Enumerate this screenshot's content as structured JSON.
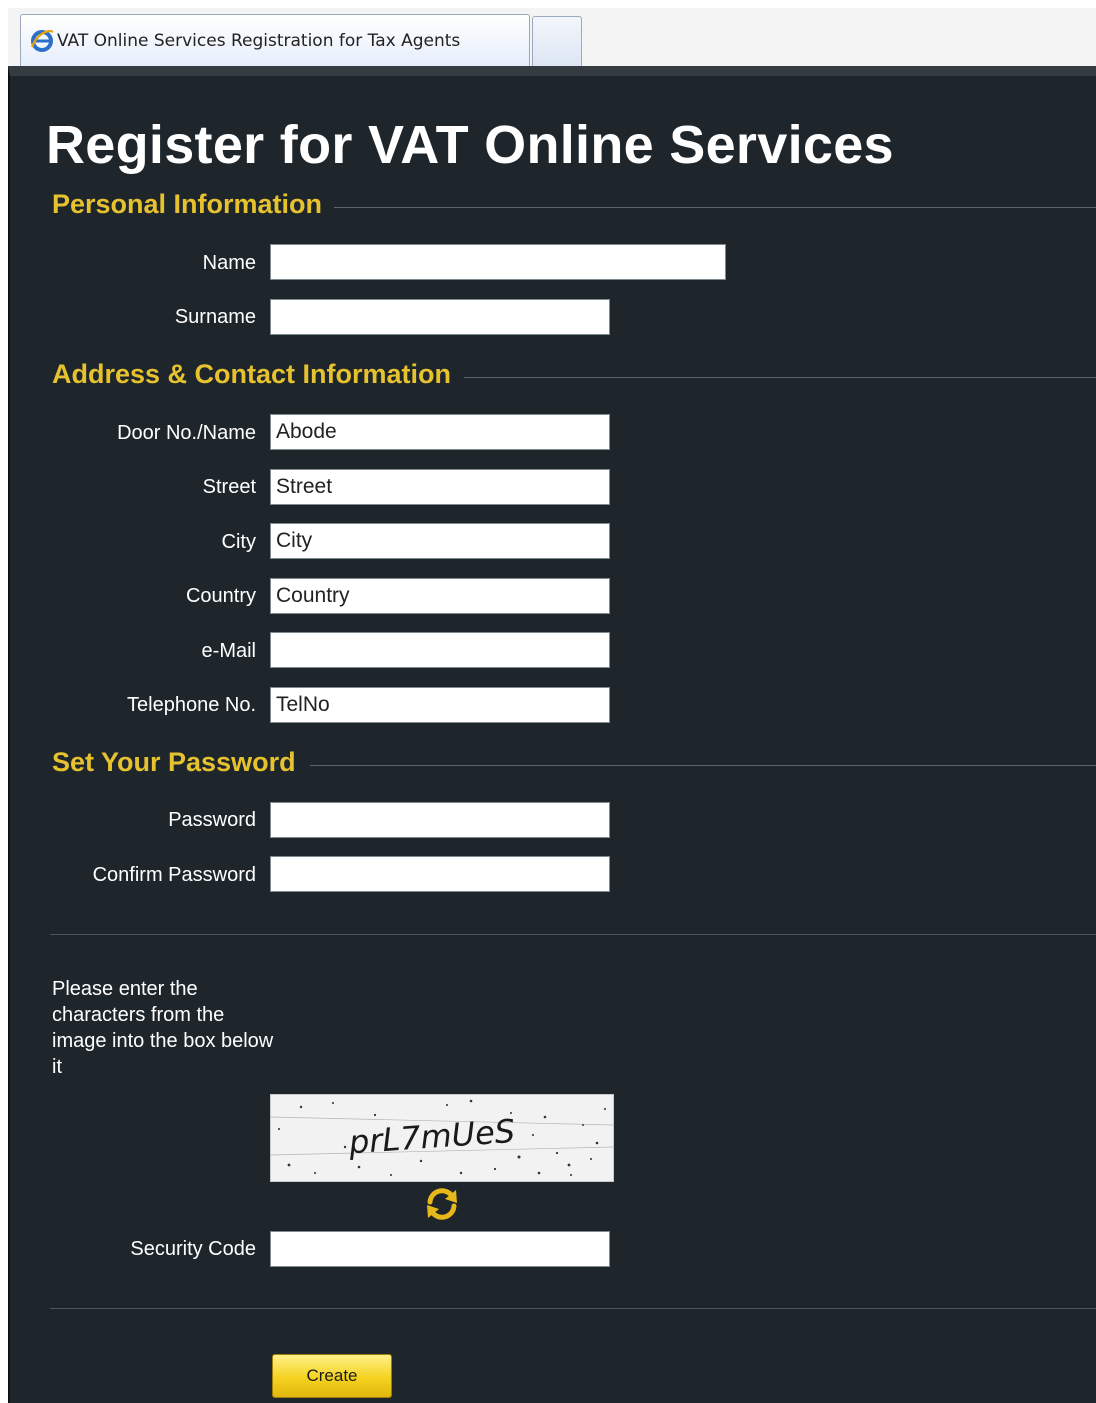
{
  "browser": {
    "tab_title": "VAT Online Services Registration for Tax Agents"
  },
  "page": {
    "title": "Register for VAT Online Services"
  },
  "sections": {
    "personal": {
      "title": "Personal Information",
      "name_label": "Name",
      "name_value": "",
      "surname_label": "Surname",
      "surname_value": ""
    },
    "address": {
      "title": "Address & Contact Information",
      "door_label": "Door No./Name",
      "door_value": "Abode",
      "street_label": "Street",
      "street_value": "Street",
      "city_label": "City",
      "city_value": "City",
      "country_label": "Country",
      "country_value": "Country",
      "email_label": "e-Mail",
      "email_value": "",
      "telephone_label": "Telephone No.",
      "telephone_value": "TelNo"
    },
    "password": {
      "title": "Set Your Password",
      "password_label": "Password",
      "password_value": "",
      "confirm_label": "Confirm Password",
      "confirm_value": ""
    }
  },
  "captcha": {
    "instructions": "Please enter the characters from the image into the box below it",
    "image_text": "prL7mUeS",
    "refresh_icon": "refresh-icon",
    "security_code_label": "Security Code",
    "security_code_value": ""
  },
  "actions": {
    "create_label": "Create"
  },
  "colors": {
    "background": "#1f262b",
    "accent_heading": "#e6c22e",
    "button": "#f4d21f"
  }
}
